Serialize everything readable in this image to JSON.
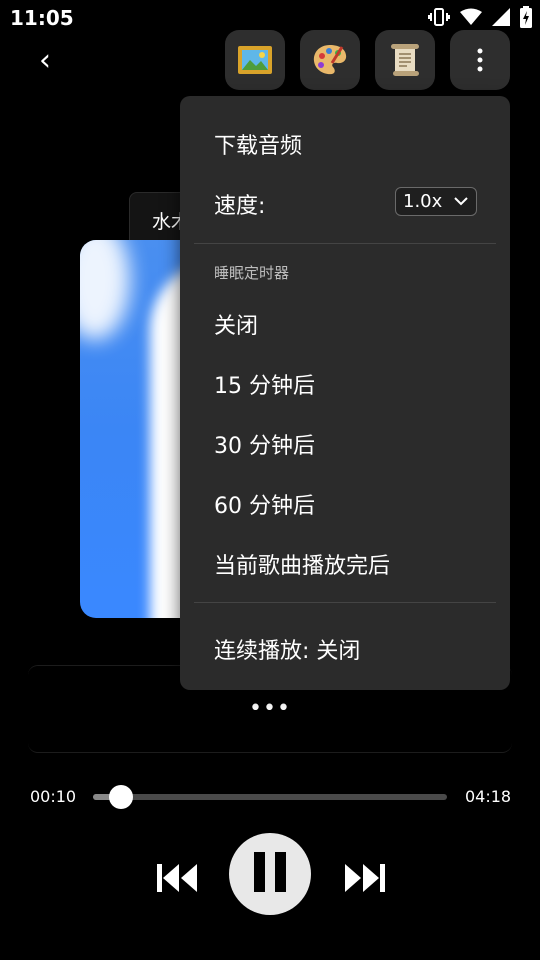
{
  "status_bar": {
    "time": "11:05",
    "icons": [
      "vibrate-icon",
      "wifi-icon",
      "signal-icon",
      "battery-charging-icon"
    ]
  },
  "top_bar": {
    "back_label": "‹",
    "tools": [
      {
        "name": "picture-icon"
      },
      {
        "name": "palette-icon"
      },
      {
        "name": "scroll-icon"
      },
      {
        "name": "more-vert-icon"
      }
    ]
  },
  "background": {
    "chip_label": "水木",
    "lyrics_more": "•••",
    "colors": {
      "cover_blue": "#3b86f5"
    }
  },
  "player": {
    "time_current": "00:10",
    "time_total": "04:18",
    "progress": 0.08
  },
  "menu": {
    "download": "下载音频",
    "speed_label": "速度:",
    "speed_value": "1.0x",
    "sleep_timer_header": "睡眠定时器",
    "timer_options": [
      "关闭",
      "15 分钟后",
      "30 分钟后",
      "60 分钟后",
      "当前歌曲播放完后"
    ],
    "continuous_play": "连续播放: 关闭"
  }
}
